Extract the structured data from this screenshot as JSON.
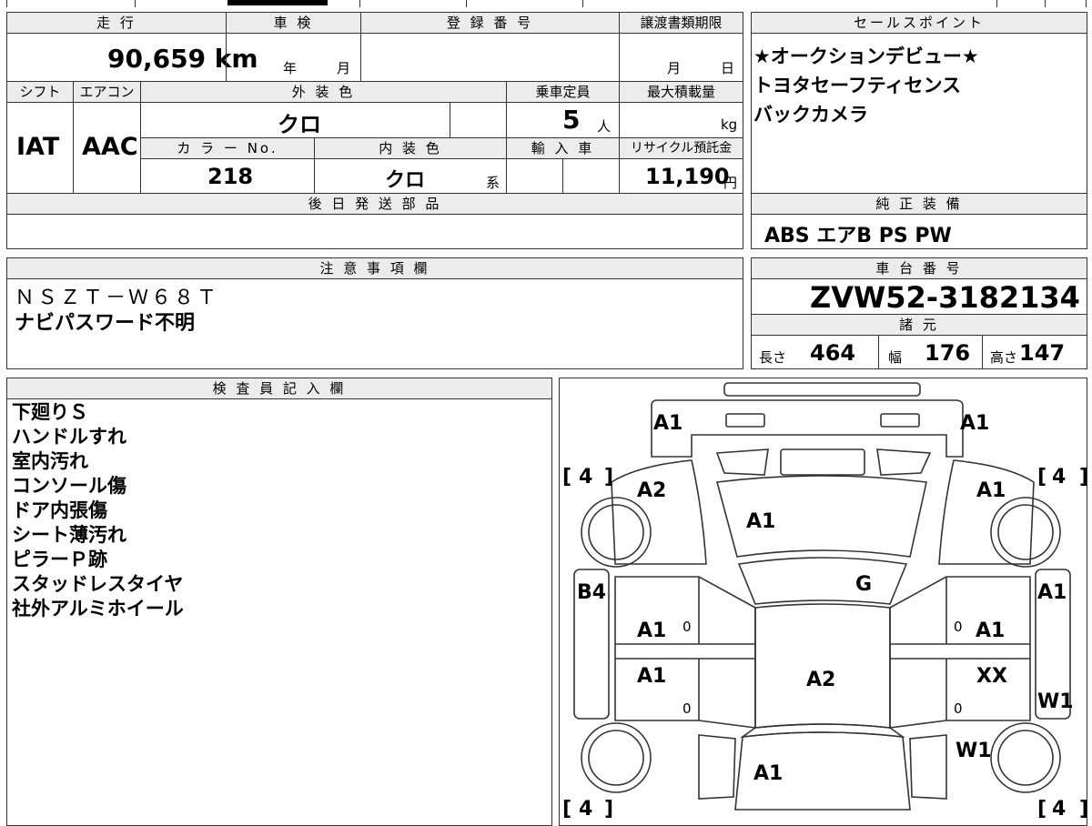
{
  "headers": {
    "mileage": "走 行",
    "inspection": "車 検",
    "registration": "登 録 番 号",
    "transfer_deadline": "譲渡書類期限",
    "sales_points": "セールスポイント",
    "shift": "シフト",
    "aircon": "エアコン",
    "exterior_color": "外 装 色",
    "capacity": "乗車定員",
    "max_load": "最大積載量",
    "color_no": "カ ラ ー No.",
    "interior_color": "内 装 色",
    "import": "輸 入 車",
    "recycle": "リサイクル預託金",
    "later_parts": "後 日 発 送 部 品",
    "genuine_equipment": "純 正 装 備",
    "notes": "注 意 事 項 欄",
    "chassis": "車 台 番 号",
    "specs": "諸 元",
    "inspector": "検 査 員 記 入 欄"
  },
  "values": {
    "mileage": "90,659 km",
    "inspection_year": "年",
    "inspection_month": "月",
    "transfer_month": "月",
    "transfer_day": "日",
    "shift": "IAT",
    "aircon": "AAC",
    "exterior_color": "クロ",
    "capacity": "5",
    "capacity_unit": "人",
    "max_load_unit": "kg",
    "color_no": "218",
    "interior_color": "クロ",
    "interior_suffix": "系",
    "recycle": "11,190",
    "recycle_unit": "円",
    "genuine_equipment": "ABS エアB PS PW",
    "chassis": "ZVW52-3182134",
    "length_label": "長さ",
    "length": "464",
    "width_label": "幅",
    "width": "176",
    "height_label": "高さ",
    "height": "147"
  },
  "sales_points": [
    "★オークションデビュー★",
    "トヨタセーフティセンス",
    "バックカメラ"
  ],
  "notes": [
    "ＮＳＺＴ－Ｗ６８Ｔ",
    "ナビパスワード不明"
  ],
  "inspector_notes": [
    "下廻りＳ",
    "ハンドルすれ",
    "室内汚れ",
    "コンソール傷",
    "ドア内張傷",
    "シート薄汚れ",
    "ピラーＰ跡",
    "スタッドレスタイヤ",
    "社外アルミホイール"
  ],
  "diagram": {
    "front_left": "A1",
    "front_right": "A1",
    "tire_fl": "4",
    "tire_fr": "4",
    "tire_rl": "4",
    "tire_rr": "4",
    "fender_fl": "A2",
    "fender_fr": "A1",
    "hood": "A1",
    "windshield": "G",
    "pillar_left": "B4",
    "pillar_right": "A1",
    "door_fl": "A1",
    "door_fr": "A1",
    "door_rl": "A1",
    "door_rr": "XX",
    "roof": "A2",
    "sill_right": "W1",
    "quarter_right": "W1",
    "trunk": "A1",
    "mark_fl": "0",
    "mark_fr": "0",
    "mark_rl": "0",
    "mark_rr": "0"
  }
}
